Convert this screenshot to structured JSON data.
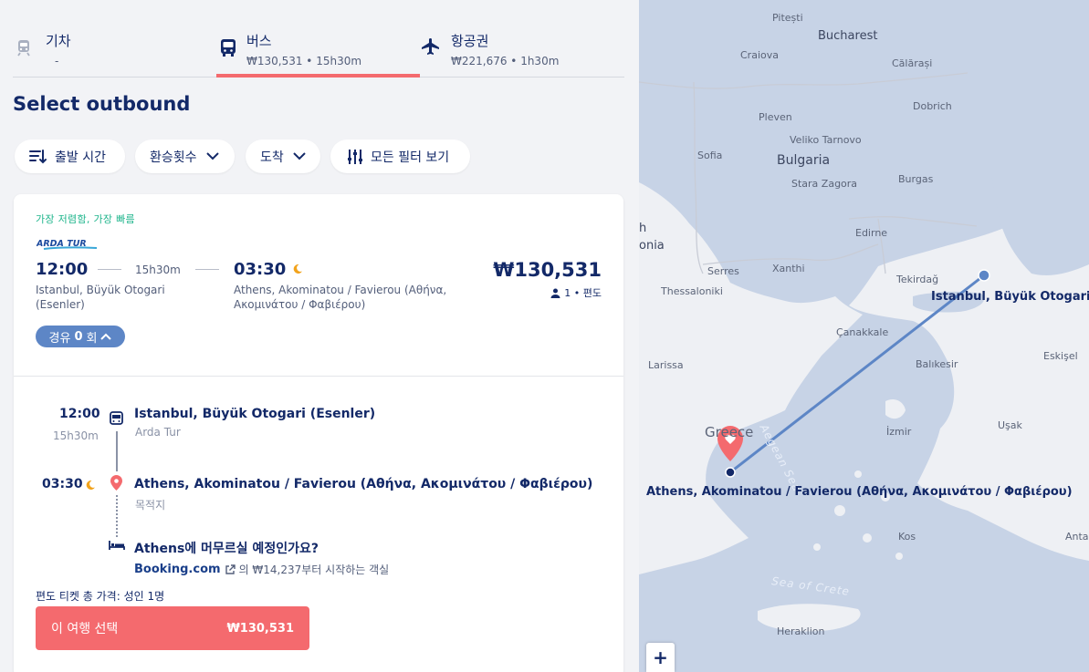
{
  "tabs": [
    {
      "name": "기차",
      "sub": "-",
      "icon": "train-icon"
    },
    {
      "name": "버스",
      "sub": "₩130,531 • 15h30m",
      "icon": "bus-icon",
      "active": true
    },
    {
      "name": "항공권",
      "sub": "₩221,676 • 1h30m",
      "icon": "plane-icon"
    }
  ],
  "page_title": "Select outbound",
  "filters": {
    "departure_time": "출발 시간",
    "transfers": "환승횟수",
    "arrival": "도착",
    "all_filters": "모든 필터 보기"
  },
  "result": {
    "tags": "가장 저렴함, 가장 빠름",
    "operator_logo": "ARDA TUR",
    "departure_time": "12:00",
    "duration": "15h30m",
    "arrival_time": "03:30",
    "departure_station": "Istanbul, Büyük Otogari (Esenler)",
    "arrival_station": "Athens, Akominatou / Favierou (Αθήνα, Ακομινάτου / Φαβιέρου)",
    "price": "₩130,531",
    "passengers": "1 • 편도",
    "stops_prefix": "경유",
    "stops_count": "0",
    "stops_suffix": "회"
  },
  "itinerary": {
    "dep_time": "12:00",
    "duration": "15h30m",
    "dep_station": "Istanbul, Büyük Otogari (Esenler)",
    "operator": "Arda Tur",
    "arr_time": "03:30",
    "arr_station": "Athens, Akominatou / Favierou (Αθήνα, Ακομινάτου / Φαβιέρου)",
    "destination_label": "목적지",
    "hotel_question": "Athens에 머무르실 예정인가요?",
    "booking_brand": "Booking.com",
    "booking_text": "의 ₩14,237부터 시작하는 객실",
    "total_label": "편도 티켓 총 가격: 성인 1명",
    "select_label": "이 여행 선택",
    "select_price": "₩130,531"
  },
  "map": {
    "places": {
      "pitesti": "Pitești",
      "bucharest": "Bucharest",
      "craiova": "Craiova",
      "calarasi": "Călărași",
      "pleven": "Pleven",
      "dobrich": "Dobrich",
      "veliko": "Veliko Tarnovo",
      "sofia": "Sofia",
      "bulgaria": "Bulgaria",
      "stara": "Stara Zagora",
      "burgas": "Burgas",
      "north": "h",
      "macedonia": "onia",
      "edirne": "Edirne",
      "xanthi": "Xanthi",
      "serres": "Serres",
      "tekirdag": "Tekirdağ",
      "thessaloniki": "Thessaloniki",
      "canakkale": "Çanakkale",
      "larissa": "Larissa",
      "balikesir": "Balıkesir",
      "eskisehir": "Eskişel",
      "aegean": "Aegean Sea",
      "greece": "Greece",
      "izmir": "İzmir",
      "usak": "Uşak",
      "kos": "Kos",
      "antalya": "Anta",
      "crete_sea": "Sea of Crete",
      "heraklion": "Heraklion"
    },
    "origin_label": "Istanbul, Büyük Otogari (Esenler)",
    "destination_label": "Athens, Akominatou / Favierou (Αθήνα, Ακομινάτου / Φαβιέρου)",
    "zoom_in": "+"
  },
  "colors": {
    "accent": "#f46a6e",
    "navy": "#132968",
    "green_tag": "#1fb58c",
    "route": "#5d86c6",
    "land": "#eef0f4",
    "sea": "#c7d3e6"
  }
}
